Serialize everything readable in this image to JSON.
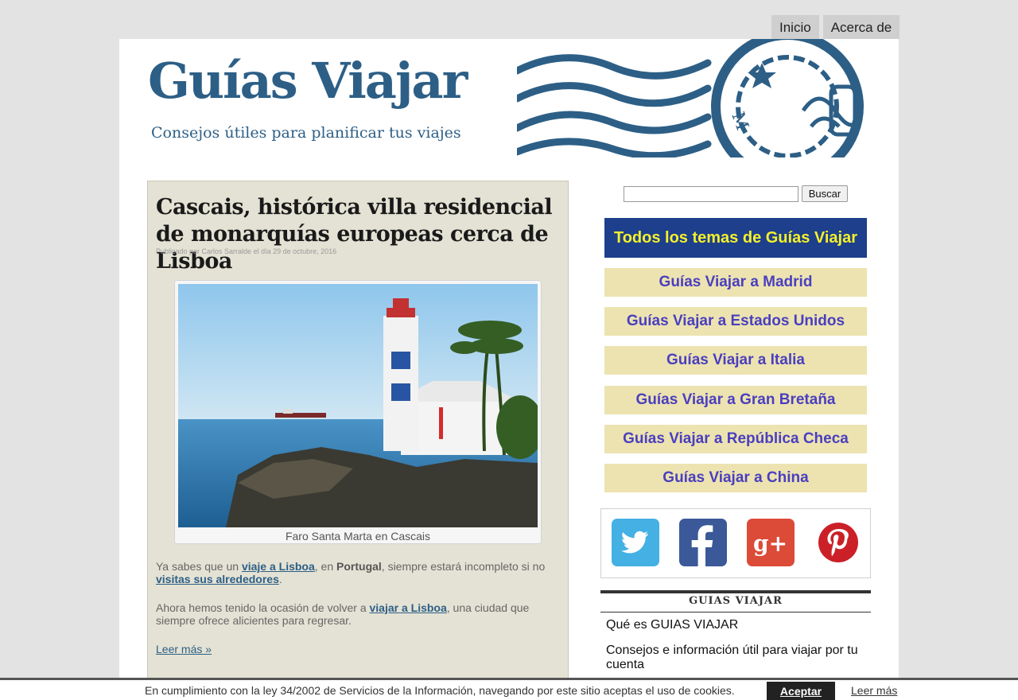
{
  "nav": {
    "home": "Inicio",
    "about": "Acerca de"
  },
  "header": {
    "title": "Guías Viajar",
    "tagline": "Consejos útiles para planificar tus viajes"
  },
  "post": {
    "title": "Cascais, histórica villa residencial de monarquías europeas cerca de Lisboa",
    "meta": "Publicado por Carlos Sarralde el día 29 de octubre, 2016",
    "caption": "Faro Santa Marta en Cascais",
    "p1": {
      "a": "Ya sabes que un ",
      "link1": "viaje a Lisboa",
      "b": ", en ",
      "bold": "Portugal",
      "c": ", siempre estará incompleto si no ",
      "link2": "visitas sus alrededores",
      "d": "."
    },
    "p2": {
      "a": "Ahora hemos tenido la ocasión de volver a ",
      "link": "viajar a Lisboa",
      "b": ", una ciudad que siempre ofrece alicientes para regresar."
    },
    "read_more": "Leer más »"
  },
  "sidebar": {
    "search_button": "Buscar",
    "all_topics": "Todos los temas de Guías Viajar",
    "guides": [
      "Guías Viajar a Madrid",
      "Guías Viajar a Estados Unidos",
      "Guías Viajar a Italia",
      "Guías Viajar a Gran Bretaña",
      "Guías Viajar a República Checa",
      "Guías Viajar a China"
    ],
    "social": [
      "twitter",
      "facebook",
      "google-plus",
      "pinterest"
    ],
    "widget_title": "GUIAS VIAJAR",
    "widget_items": [
      "Qué es GUIAS VIAJAR",
      "Consejos e información útil para viajar por tu cuenta"
    ]
  },
  "cookie": {
    "text": "En cumplimiento con la ley 34/2002 de Servicios de la Información, navegando por este sitio aceptas el uso de cookies.",
    "accept": "Aceptar",
    "more": "Leer más"
  }
}
